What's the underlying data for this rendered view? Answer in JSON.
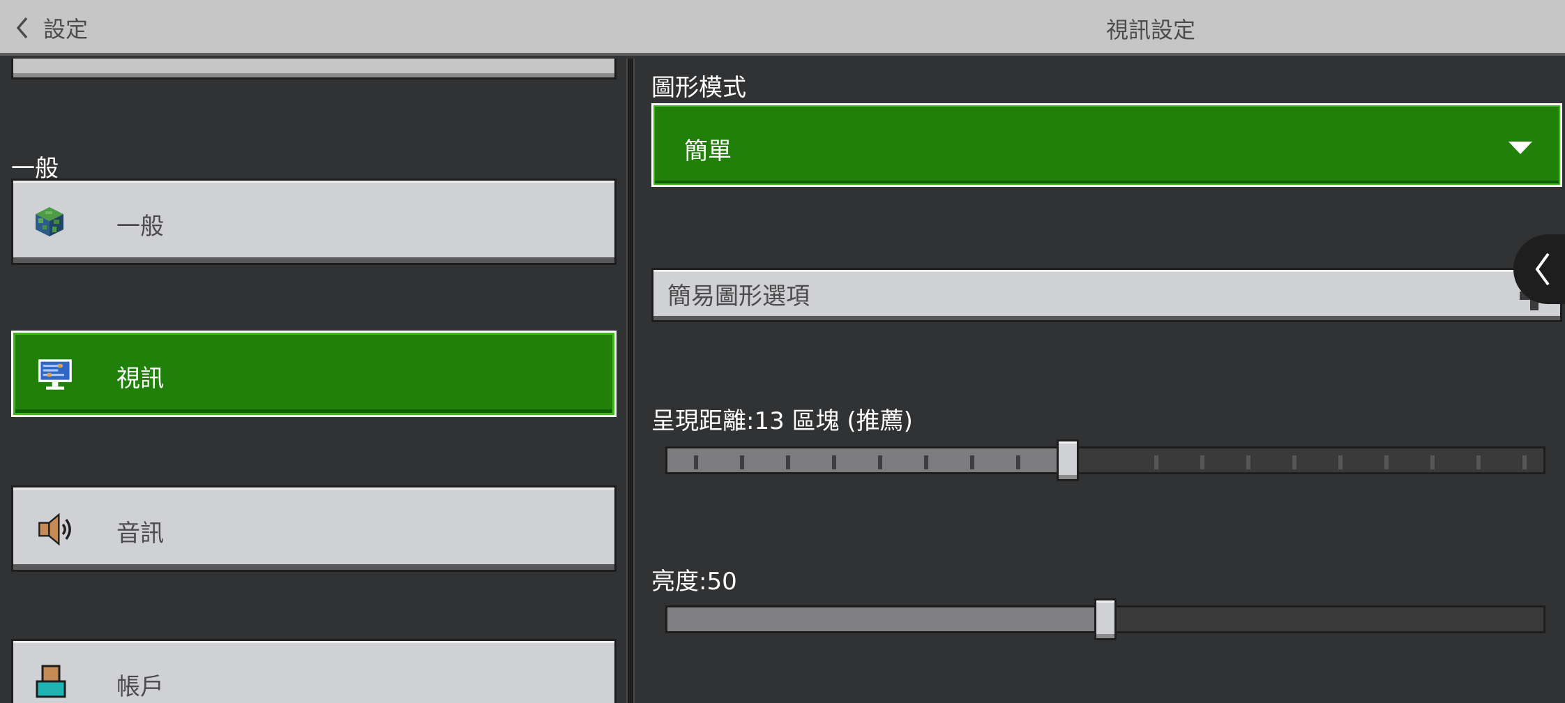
{
  "header": {
    "back_label": "設定",
    "title": "視訊設定"
  },
  "sidebar": {
    "section_label": "一般",
    "items": [
      {
        "label": "一般",
        "icon": "globe-cube-icon",
        "active": false
      },
      {
        "label": "視訊",
        "icon": "monitor-icon",
        "active": true
      },
      {
        "label": "音訊",
        "icon": "speaker-icon",
        "active": false
      },
      {
        "label": "帳戶",
        "icon": "account-icon",
        "active": false
      }
    ]
  },
  "main": {
    "graphics_mode": {
      "label": "圖形模式",
      "value": "簡單"
    },
    "simple_graphics_options": {
      "label": "簡易圖形選項"
    },
    "render_distance": {
      "label": "呈現距離:13 區塊 (推薦)",
      "value": 13
    },
    "brightness": {
      "label": "亮度:50",
      "value": 50
    }
  },
  "colors": {
    "accent_green": "#21800a",
    "button_gray": "#d0d1d4",
    "background": "#313233"
  }
}
